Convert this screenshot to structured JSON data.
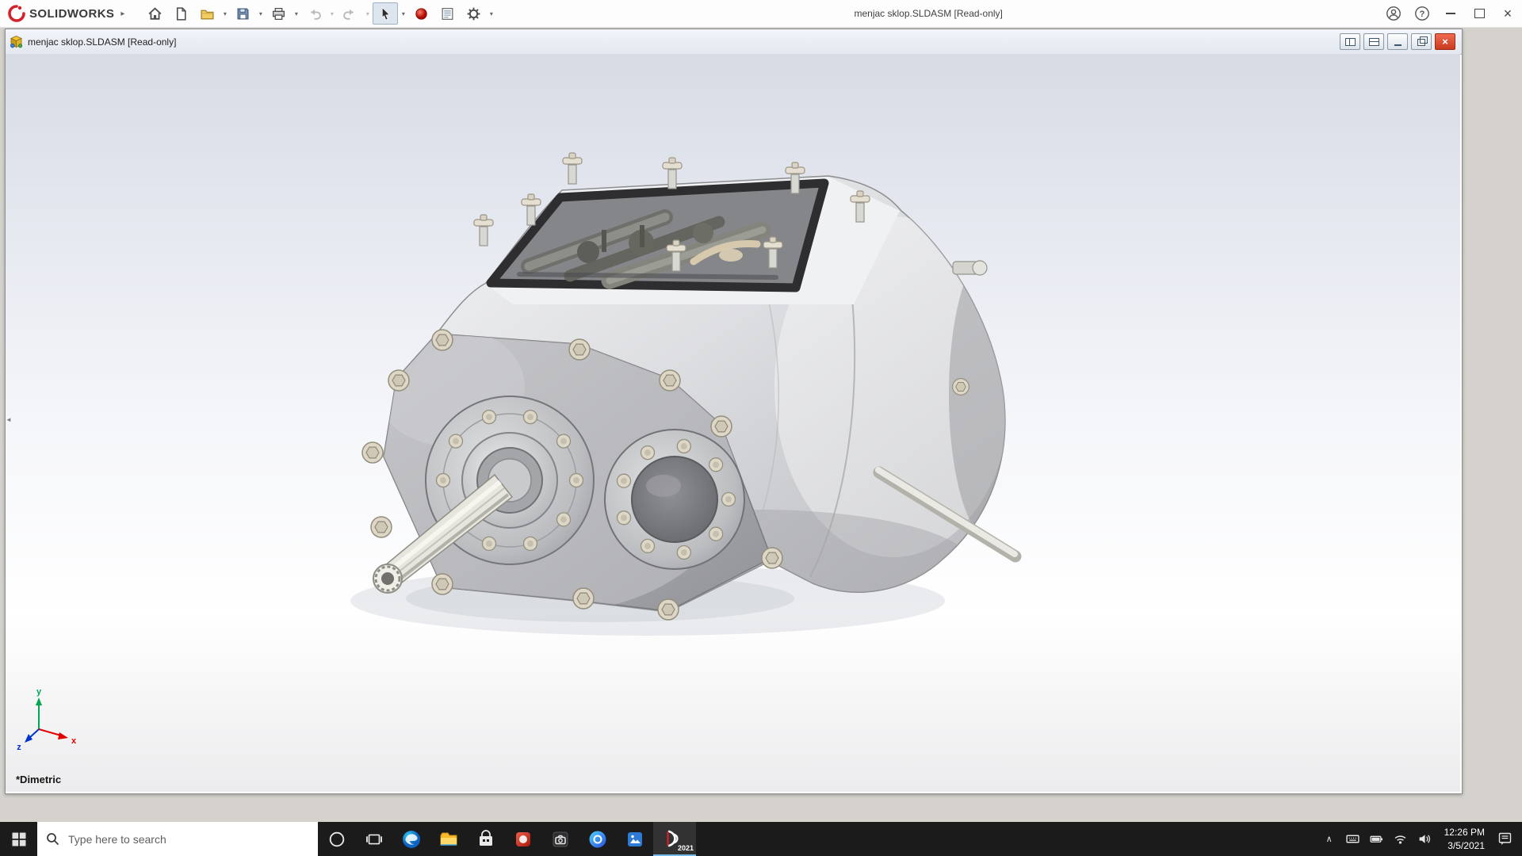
{
  "colors": {
    "brand_red": "#d2232a",
    "taskbar_bg": "#1b1b1b",
    "child_close_red": "#c93a20",
    "active_app_underline": "#76b9ed",
    "triad_x_red": "#e00000",
    "triad_y_green": "#00a651",
    "triad_z_blue": "#0033cc"
  },
  "app_titlebar": {
    "brand": "SOLIDWORKS",
    "document_title": "menjac sklop.SLDASM [Read-only]"
  },
  "child_window": {
    "title": "menjac sklop.SLDASM [Read-only]"
  },
  "viewport": {
    "orientation_label": "*Dimetric",
    "triad": {
      "x": "x",
      "y": "y",
      "z": "z"
    }
  },
  "taskbar": {
    "search_placeholder": "Type here to search",
    "solidworks_version_badge": "2021",
    "clock_time": "12:26 PM",
    "clock_date": "3/5/2021"
  },
  "icons": {
    "dropdown_chevron": "▾",
    "flyout_arrow": "▸",
    "help_glyph": "?",
    "close_glyph": "×",
    "tray_chevron": "∧",
    "splitter_arrow": "◄"
  }
}
